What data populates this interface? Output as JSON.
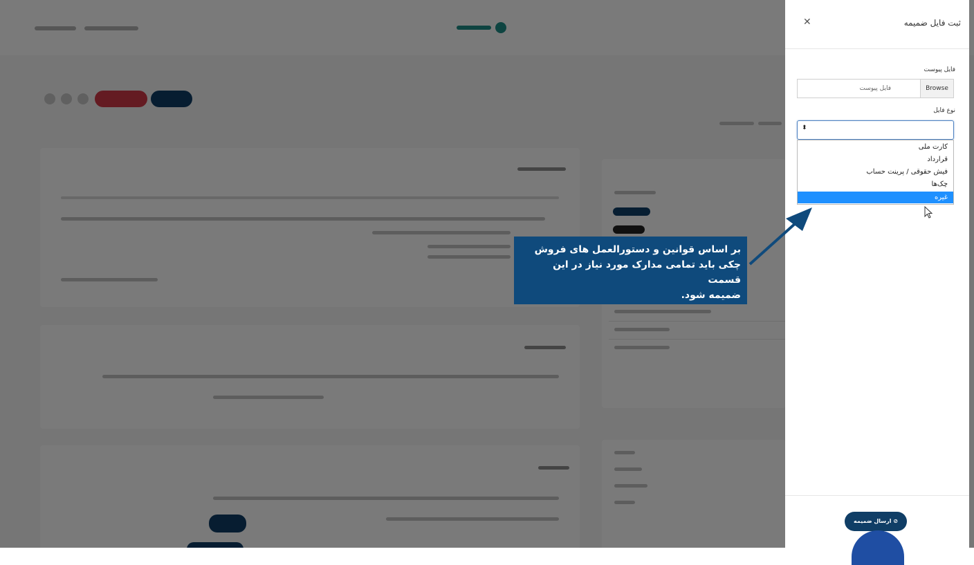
{
  "drawer": {
    "title": "ثبت فایل ضمیمه",
    "close_icon": "close-icon",
    "file_field": {
      "label": "فایل پیوست",
      "placeholder": "فایل پیوست",
      "browse_label": "Browse"
    },
    "type_field": {
      "label": "نوع فایل",
      "selected_value": "",
      "options": [
        "کارت ملی",
        "قرارداد",
        "فیش حقوقی / پرینت حساب",
        "چک‌ها",
        "غیره"
      ],
      "highlighted_option": "غیره"
    },
    "submit_label": "ارسال ضمیمه",
    "submit_icon": "check-circle-icon"
  },
  "tooltip": {
    "lines": [
      "بر اساس قوانین و دستورالعمل های فروش",
      "چکی باید تمامی مدارک مورد نیاز در این قسمت",
      "ضمیمه شود."
    ]
  },
  "colors": {
    "tooltip_bg": "#0f4a7c",
    "submit_bg": "#103e66",
    "highlight": "#1e90ff",
    "overlay": "rgba(0,0,0,0.52)"
  }
}
